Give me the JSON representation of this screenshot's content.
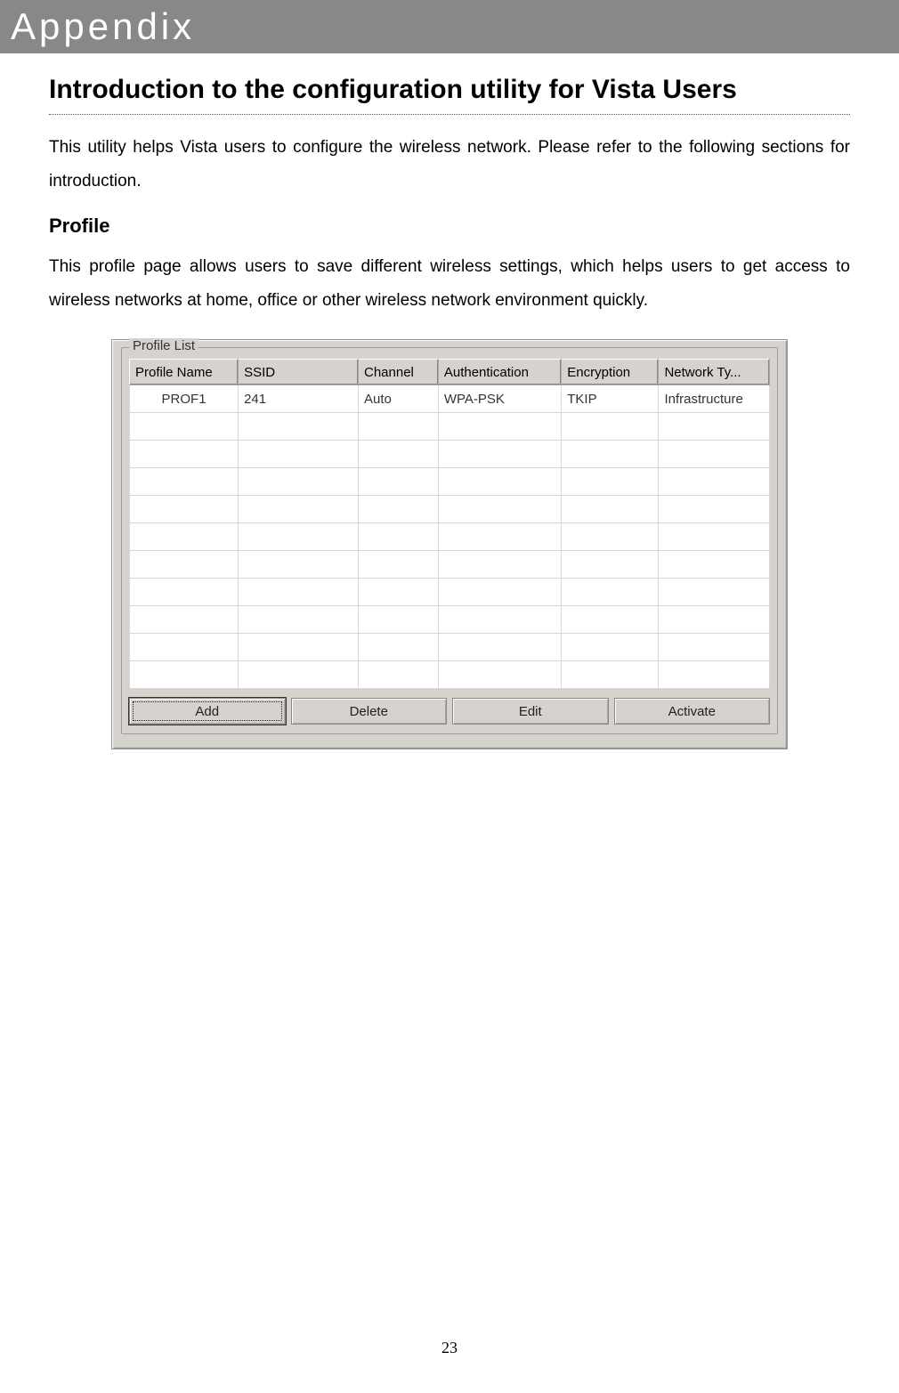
{
  "header": {
    "appendix": "Appendix"
  },
  "section": {
    "title": "Introduction to the configuration utility for Vista Users",
    "intro": "This utility helps Vista users to configure the wireless network. Please refer to the following sections for introduction.",
    "profile_title": "Profile",
    "profile_text": "This profile page allows users to save different wireless settings, which helps users to get access to wireless networks at home, office or other wireless network environment quickly."
  },
  "screenshot": {
    "groupbox_title": "Profile List",
    "columns": [
      "Profile Name",
      "SSID",
      "Channel",
      "Authentication",
      "Encryption",
      "Network Ty..."
    ],
    "rows": [
      {
        "profile_name": "PROF1",
        "ssid": "241",
        "channel": "Auto",
        "authentication": "WPA-PSK",
        "encryption": "TKIP",
        "network_type": "Infrastructure"
      }
    ],
    "empty_row_count": 10,
    "buttons": {
      "add": "Add",
      "delete": "Delete",
      "edit": "Edit",
      "activate": "Activate"
    }
  },
  "page_number": "23"
}
